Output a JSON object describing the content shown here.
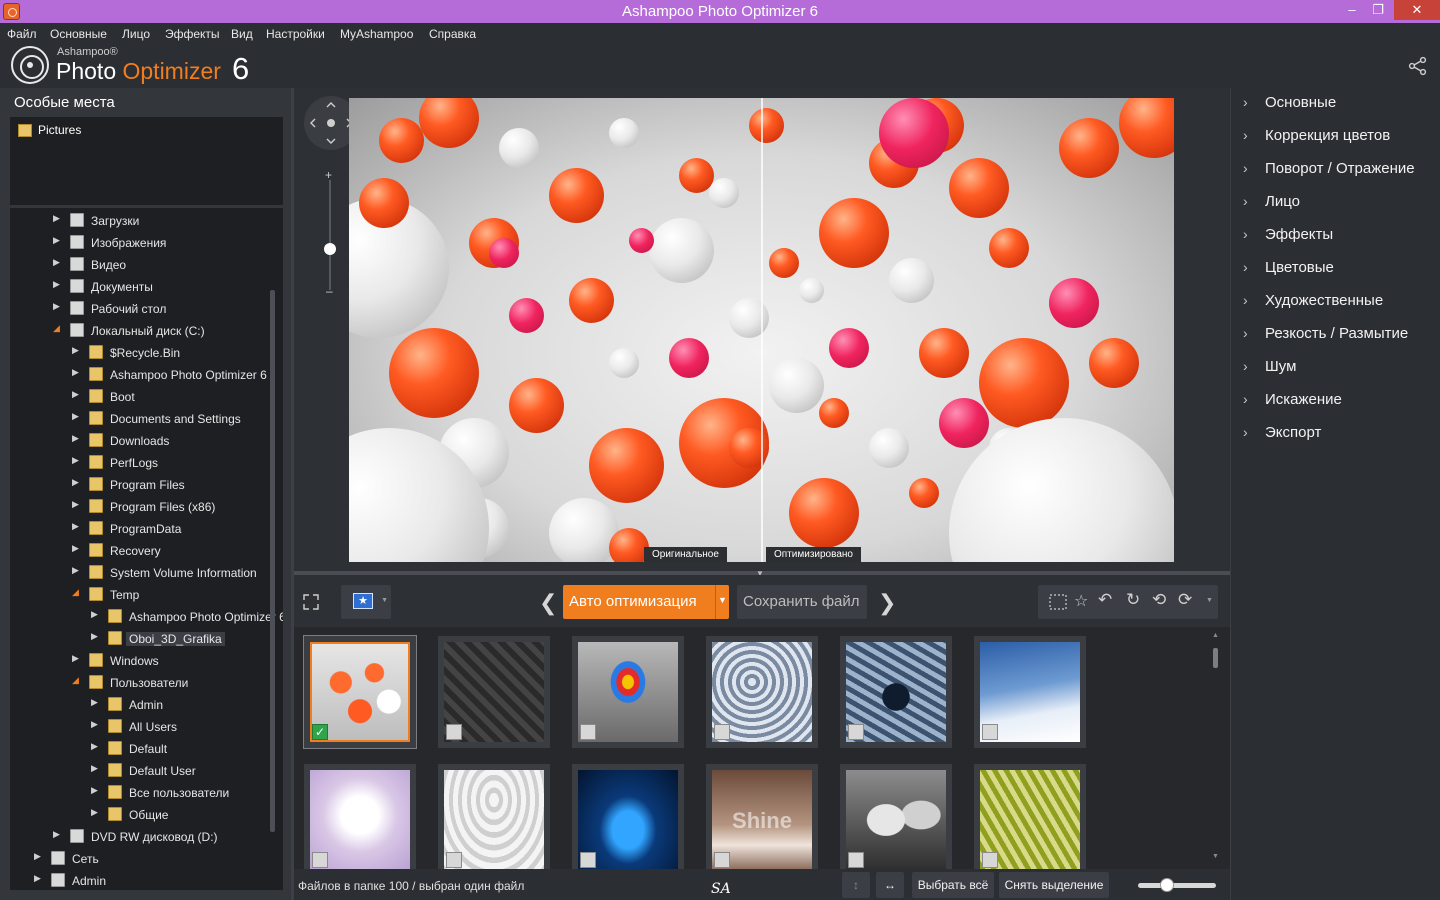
{
  "window": {
    "title": "Ashampoo Photo Optimizer 6"
  },
  "menu": [
    "Файл",
    "Основные",
    "Лицо",
    "Эффекты",
    "Вид",
    "Настройки",
    "MyAshampoo",
    "Справка"
  ],
  "logo": {
    "brand": "Ashampoo®",
    "product_a": "Photo ",
    "product_b": "Optimizer",
    "version": "6"
  },
  "left_panel": {
    "title": "Особые места",
    "places": [
      "Pictures"
    ],
    "tree": [
      {
        "label": "Загрузки",
        "level": 0,
        "state": "closed",
        "type": "sys"
      },
      {
        "label": "Изображения",
        "level": 0,
        "state": "closed",
        "type": "sys"
      },
      {
        "label": "Видео",
        "level": 0,
        "state": "closed",
        "type": "sys"
      },
      {
        "label": "Документы",
        "level": 0,
        "state": "closed",
        "type": "sys"
      },
      {
        "label": "Рабочий стол",
        "level": 0,
        "state": "closed",
        "type": "sys"
      },
      {
        "label": "Локальный диск (C:)",
        "level": 0,
        "state": "open",
        "type": "drive"
      },
      {
        "label": "$Recycle.Bin",
        "level": 1,
        "state": "closed",
        "type": "folder"
      },
      {
        "label": "Ashampoo Photo Optimizer 6",
        "level": 1,
        "state": "closed",
        "type": "folder"
      },
      {
        "label": "Boot",
        "level": 1,
        "state": "closed",
        "type": "folder"
      },
      {
        "label": "Documents and Settings",
        "level": 1,
        "state": "closed",
        "type": "folder"
      },
      {
        "label": "Downloads",
        "level": 1,
        "state": "closed",
        "type": "folder"
      },
      {
        "label": "PerfLogs",
        "level": 1,
        "state": "closed",
        "type": "folder"
      },
      {
        "label": "Program Files",
        "level": 1,
        "state": "closed",
        "type": "folder"
      },
      {
        "label": "Program Files (x86)",
        "level": 1,
        "state": "closed",
        "type": "folder"
      },
      {
        "label": "ProgramData",
        "level": 1,
        "state": "closed",
        "type": "folder"
      },
      {
        "label": "Recovery",
        "level": 1,
        "state": "closed",
        "type": "folder"
      },
      {
        "label": "System Volume Information",
        "level": 1,
        "state": "closed",
        "type": "folder"
      },
      {
        "label": "Temp",
        "level": 1,
        "state": "open",
        "type": "folder"
      },
      {
        "label": "Ashampoo Photo Optimizer 6",
        "level": 2,
        "state": "closed",
        "type": "folder"
      },
      {
        "label": "Oboi_3D_Grafika",
        "level": 2,
        "state": "closed",
        "type": "folder",
        "selected": true
      },
      {
        "label": "Windows",
        "level": 1,
        "state": "closed",
        "type": "folder"
      },
      {
        "label": "Пользователи",
        "level": 1,
        "state": "open",
        "type": "folder"
      },
      {
        "label": "Admin",
        "level": 2,
        "state": "closed",
        "type": "folder"
      },
      {
        "label": "All Users",
        "level": 2,
        "state": "closed",
        "type": "folder"
      },
      {
        "label": "Default",
        "level": 2,
        "state": "closed",
        "type": "folder"
      },
      {
        "label": "Default User",
        "level": 2,
        "state": "closed",
        "type": "folder"
      },
      {
        "label": "Все пользователи",
        "level": 2,
        "state": "closed",
        "type": "folder"
      },
      {
        "label": "Общие",
        "level": 2,
        "state": "closed",
        "type": "folder"
      },
      {
        "label": "DVD RW дисковод (D:)",
        "level": 0,
        "state": "closed",
        "type": "drive"
      },
      {
        "label": "Сеть",
        "level": -1,
        "state": "closed",
        "type": "net"
      },
      {
        "label": "Admin",
        "level": -1,
        "state": "closed",
        "type": "sys"
      }
    ]
  },
  "preview": {
    "label_original": "Оригинальное",
    "label_optimized": "Оптимизировано"
  },
  "right_panel": [
    "Основные",
    "Коррекция цветов",
    "Поворот / Отражение",
    "Лицо",
    "Эффекты",
    "Цветовые",
    "Художественные",
    "Резкость / Размытие",
    "Шум",
    "Искажение",
    "Экспорт"
  ],
  "toolbar": {
    "auto_label": "Авто оптимизация",
    "save_label": "Сохранить файл"
  },
  "thumbnails": [
    {
      "name": "balls",
      "selected": true,
      "checked": true
    },
    {
      "name": "dark-cubes",
      "selected": false,
      "checked": false
    },
    {
      "name": "umbrella",
      "selected": false,
      "checked": false
    },
    {
      "name": "waves",
      "selected": false,
      "checked": false
    },
    {
      "name": "fractal",
      "selected": false,
      "checked": false
    },
    {
      "name": "plane",
      "selected": false,
      "checked": false
    },
    {
      "name": "frost",
      "selected": false,
      "checked": false
    },
    {
      "name": "tunnel",
      "selected": false,
      "checked": false
    },
    {
      "name": "car",
      "selected": false,
      "checked": false
    },
    {
      "name": "shine",
      "selected": false,
      "checked": false
    },
    {
      "name": "bowls",
      "selected": false,
      "checked": false
    },
    {
      "name": "cubes-gold",
      "selected": false,
      "checked": false
    }
  ],
  "thumb_shine_text": "Shine",
  "status": {
    "text": "Файлов в папке 100 / выбран один файл",
    "sa": "SA",
    "select_all": "Выбрать всё",
    "deselect": "Снять выделение"
  }
}
